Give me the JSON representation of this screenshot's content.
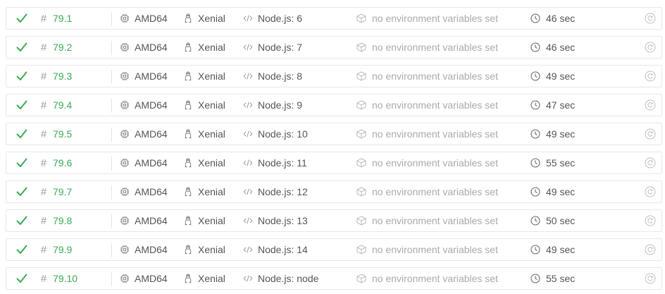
{
  "colors": {
    "passed": "#39aa56",
    "muted": "#aaaaaa",
    "text": "#555555",
    "border": "#e8e8e8"
  },
  "icons": {
    "status": "check-icon",
    "number": "hash-icon",
    "arch": "cpu-icon",
    "os": "linux-icon",
    "language": "code-icon",
    "env": "cube-icon",
    "duration": "clock-icon",
    "restart": "restart-icon"
  },
  "jobs": [
    {
      "number": "79.1",
      "arch": "AMD64",
      "dist": "Xenial",
      "lang": "Node.js: 6",
      "env": "no environment variables set",
      "duration": "46 sec"
    },
    {
      "number": "79.2",
      "arch": "AMD64",
      "dist": "Xenial",
      "lang": "Node.js: 7",
      "env": "no environment variables set",
      "duration": "46 sec"
    },
    {
      "number": "79.3",
      "arch": "AMD64",
      "dist": "Xenial",
      "lang": "Node.js: 8",
      "env": "no environment variables set",
      "duration": "49 sec"
    },
    {
      "number": "79.4",
      "arch": "AMD64",
      "dist": "Xenial",
      "lang": "Node.js: 9",
      "env": "no environment variables set",
      "duration": "47 sec"
    },
    {
      "number": "79.5",
      "arch": "AMD64",
      "dist": "Xenial",
      "lang": "Node.js: 10",
      "env": "no environment variables set",
      "duration": "49 sec"
    },
    {
      "number": "79.6",
      "arch": "AMD64",
      "dist": "Xenial",
      "lang": "Node.js: 11",
      "env": "no environment variables set",
      "duration": "55 sec"
    },
    {
      "number": "79.7",
      "arch": "AMD64",
      "dist": "Xenial",
      "lang": "Node.js: 12",
      "env": "no environment variables set",
      "duration": "49 sec"
    },
    {
      "number": "79.8",
      "arch": "AMD64",
      "dist": "Xenial",
      "lang": "Node.js: 13",
      "env": "no environment variables set",
      "duration": "50 sec"
    },
    {
      "number": "79.9",
      "arch": "AMD64",
      "dist": "Xenial",
      "lang": "Node.js: 14",
      "env": "no environment variables set",
      "duration": "49 sec"
    },
    {
      "number": "79.10",
      "arch": "AMD64",
      "dist": "Xenial",
      "lang": "Node.js: node",
      "env": "no environment variables set",
      "duration": "55 sec"
    }
  ]
}
